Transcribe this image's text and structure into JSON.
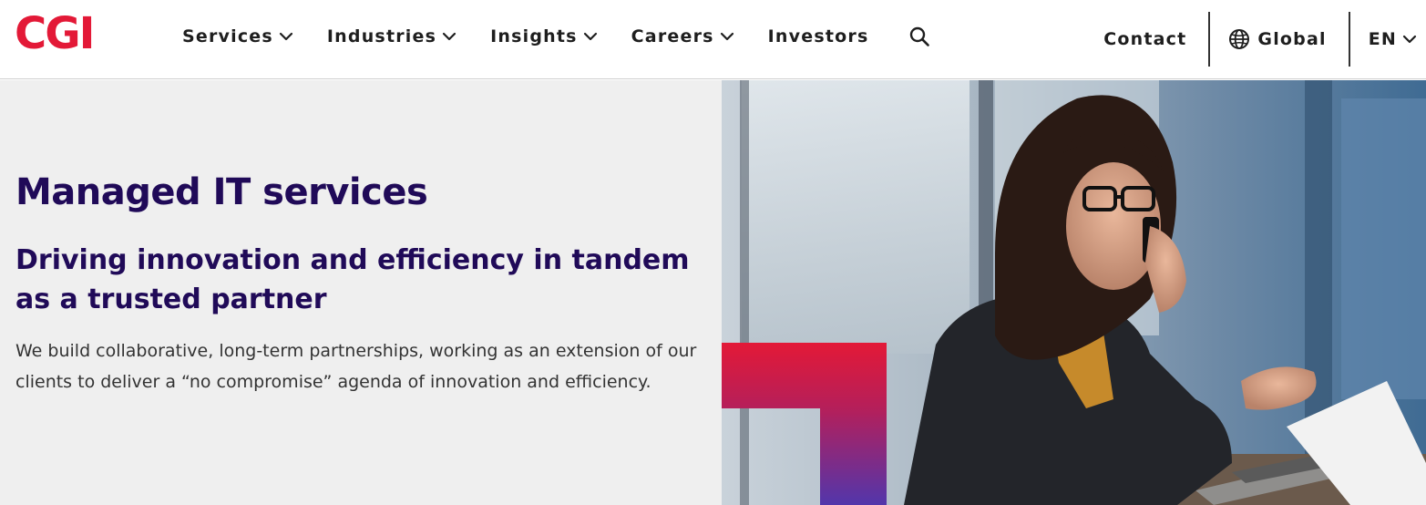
{
  "brand": {
    "logo_text": "CGI",
    "accent_color": "#e31937",
    "heading_color": "#200a58"
  },
  "nav": {
    "items": [
      {
        "label": "Services",
        "has_dropdown": true
      },
      {
        "label": "Industries",
        "has_dropdown": true
      },
      {
        "label": "Insights",
        "has_dropdown": true
      },
      {
        "label": "Careers",
        "has_dropdown": true
      },
      {
        "label": "Investors",
        "has_dropdown": false
      }
    ],
    "search_icon": "search-icon"
  },
  "utility": {
    "contact_label": "Contact",
    "global_label": "Global",
    "global_icon": "globe-icon",
    "language_label": "EN"
  },
  "hero": {
    "title": "Managed IT services",
    "subtitle": "Driving innovation and efficiency in tandem as a trusted partner",
    "body": "We build collaborative, long-term partnerships, working as an extension of our clients to deliver a “no compromise” agenda of innovation and efficiency.",
    "background_color": "#efefef",
    "gradient_colors": [
      "#e31937",
      "#5236ab"
    ]
  }
}
